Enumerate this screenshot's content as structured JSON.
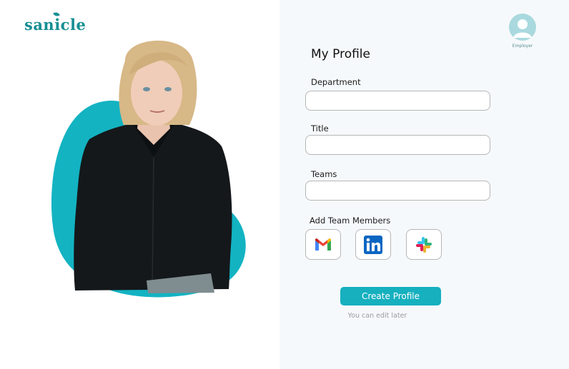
{
  "brand": {
    "logo_text": "sanicle"
  },
  "header": {
    "avatar_label": "Employer"
  },
  "form": {
    "title": "My Profile",
    "department": {
      "label": "Department",
      "value": "",
      "placeholder": ""
    },
    "job_title": {
      "label": "Title",
      "value": "",
      "placeholder": ""
    },
    "teams": {
      "label": "Teams",
      "value": "",
      "placeholder": ""
    },
    "add_members_label": "Add Team Members",
    "integrations": [
      {
        "icon": "gmail-icon"
      },
      {
        "icon": "linkedin-icon"
      },
      {
        "icon": "slack-icon"
      }
    ],
    "submit_label": "Create Profile",
    "hint": "You can edit later"
  },
  "colors": {
    "brand": "#168f93",
    "accent": "#16b0bf",
    "blob": "#13b3c2",
    "panel_bg": "#f6f9fb"
  }
}
